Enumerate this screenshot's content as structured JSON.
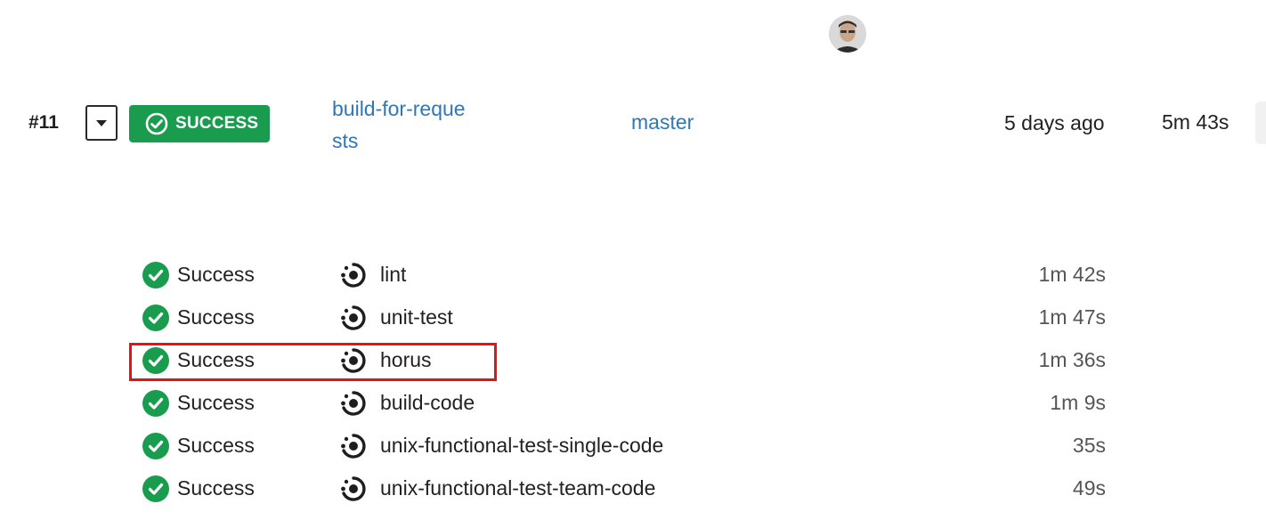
{
  "build": {
    "number": "#11",
    "status_label": "SUCCESS",
    "branch": "build-for-requests",
    "target_branch": "master",
    "time_ago": "5 days ago",
    "duration": "5m 43s"
  },
  "jobs": [
    {
      "status": "Success",
      "name": "lint",
      "duration": "1m 42s"
    },
    {
      "status": "Success",
      "name": "unit-test",
      "duration": "1m 47s"
    },
    {
      "status": "Success",
      "name": "horus",
      "duration": "1m 36s"
    },
    {
      "status": "Success",
      "name": "build-code",
      "duration": "1m 9s"
    },
    {
      "status": "Success",
      "name": "unix-functional-test-single-code",
      "duration": "35s"
    },
    {
      "status": "Success",
      "name": "unix-functional-test-team-code",
      "duration": "49s"
    }
  ],
  "colors": {
    "success_green": "#1a9c4f",
    "link_blue": "#2f77b5",
    "highlight_red": "#e51414"
  },
  "icons": {
    "toggle": "chevron-down-icon",
    "status": "check-circle-icon",
    "job": "job-target-icon"
  }
}
